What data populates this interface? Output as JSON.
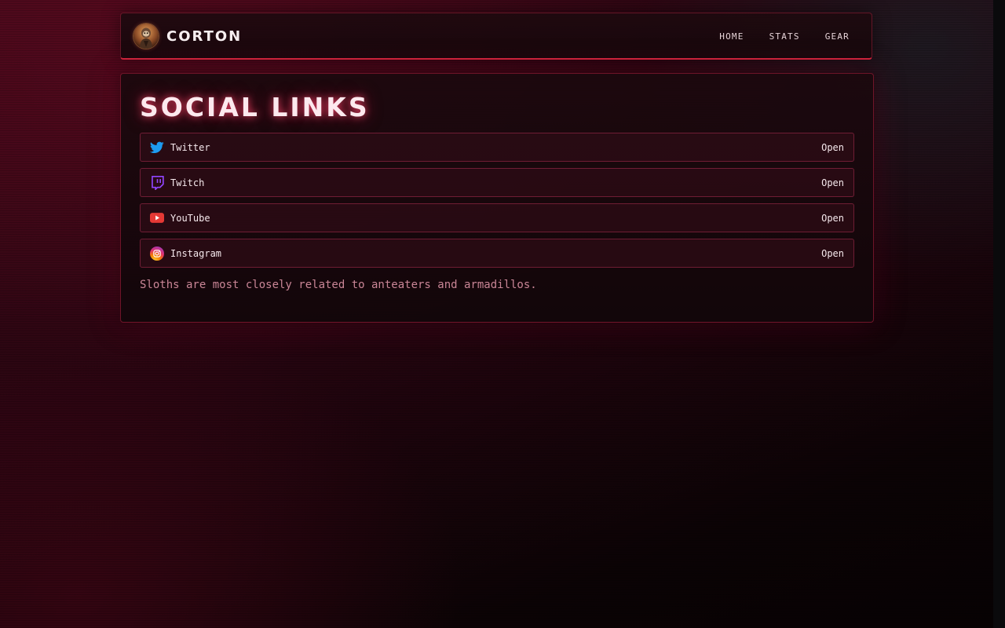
{
  "header": {
    "brand": "CORTON",
    "nav": [
      "HOME",
      "STATS",
      "GEAR"
    ]
  },
  "main": {
    "title": "SOCIAL LINKS",
    "links": [
      {
        "label": "Twitter",
        "action": "Open",
        "icon": "twitter-icon",
        "color": "#1d9bf0"
      },
      {
        "label": "Twitch",
        "action": "Open",
        "icon": "twitch-icon",
        "color": "#9146ff"
      },
      {
        "label": "YouTube",
        "action": "Open",
        "icon": "youtube-icon",
        "color": "#e53935"
      },
      {
        "label": "Instagram",
        "action": "Open",
        "icon": "instagram-icon",
        "color": "#e1306c"
      }
    ],
    "fact": "Sloths are most closely related to anteaters and armadillos."
  },
  "theme": {
    "accent": "#d3263e",
    "background": "#1a050b",
    "fact_text": "#c98596"
  }
}
